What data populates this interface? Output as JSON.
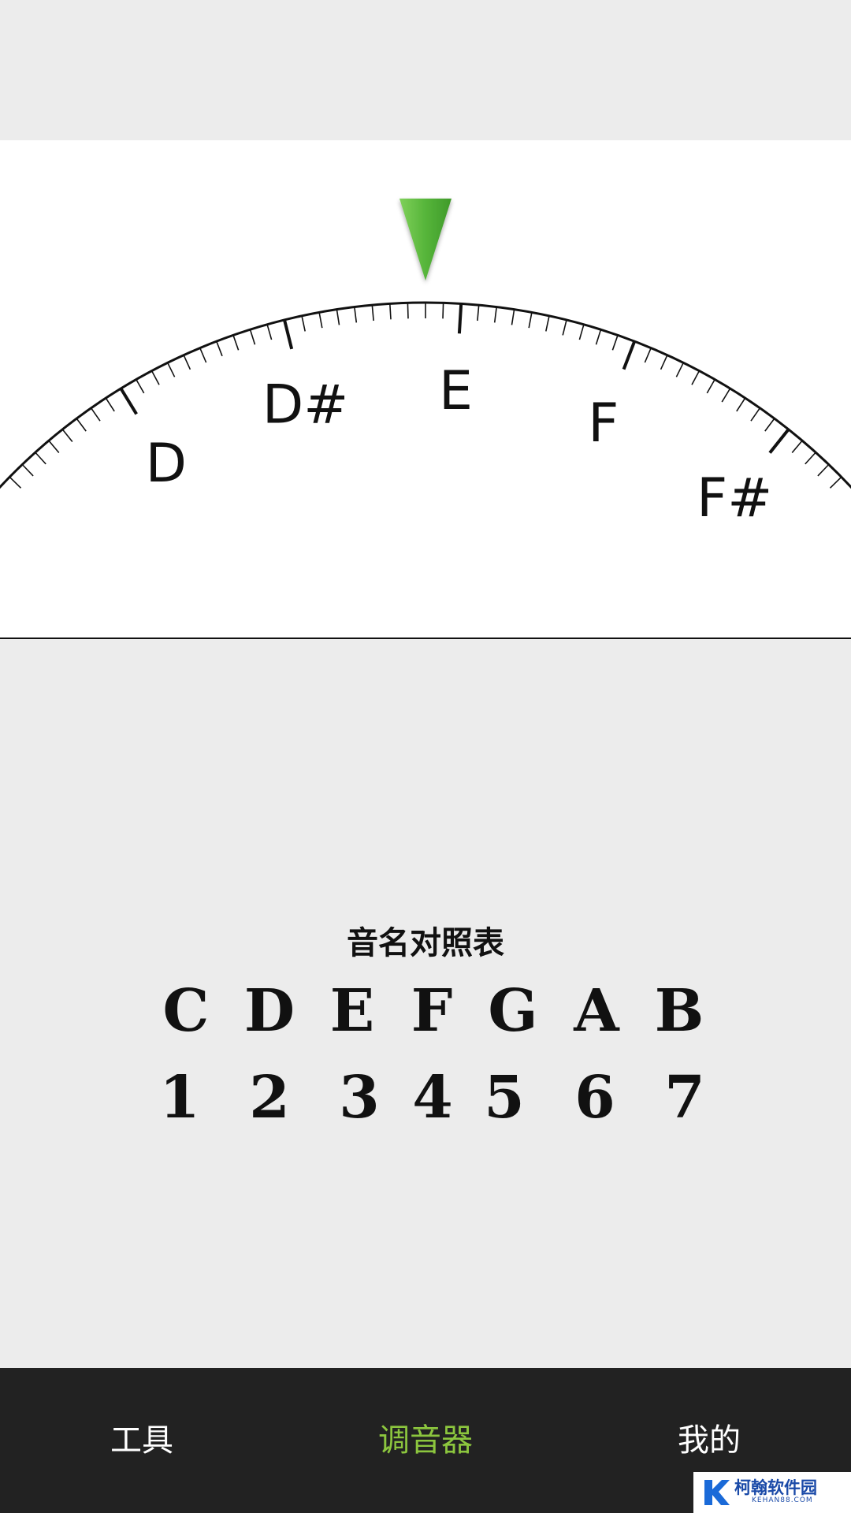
{
  "tuner": {
    "notes": [
      {
        "id": "d",
        "label": "D"
      },
      {
        "id": "dsharp",
        "label": "D#"
      },
      {
        "id": "e",
        "label": "E"
      },
      {
        "id": "f",
        "label": "F"
      },
      {
        "id": "fsharp",
        "label": "F#"
      }
    ],
    "indicator_color": "#56b53a"
  },
  "note_chart": {
    "title": "音名对照表",
    "letters": [
      "C",
      "D",
      "E",
      "F",
      "G",
      "A",
      "B"
    ],
    "numbers": [
      "1",
      "2",
      "3",
      "4",
      "5",
      "6",
      "7"
    ]
  },
  "bottom_nav": {
    "items": [
      {
        "label": "工具",
        "active": false
      },
      {
        "label": "调音器",
        "active": true
      },
      {
        "label": "我的",
        "active": false
      }
    ],
    "active_color": "#8cc63e"
  },
  "watermark": {
    "text": "柯翰软件园",
    "subtext": "KEHAN88.COM"
  }
}
